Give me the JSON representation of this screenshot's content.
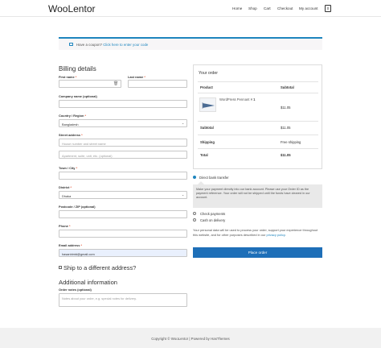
{
  "header": {
    "brand": "WooLentor",
    "nav": [
      "Home",
      "Shop",
      "Cart",
      "Checkout",
      "My account"
    ],
    "cart_count": "0"
  },
  "coupon": {
    "prefix": "Have a coupon? ",
    "link": "Click here to enter your code"
  },
  "billing": {
    "title": "Billing details",
    "required_mark": "*",
    "fields": {
      "first_name": {
        "label": "First name"
      },
      "last_name": {
        "label": "Last name"
      },
      "company": {
        "label": "Company name (optional)"
      },
      "country": {
        "label": "Country / Region",
        "value": "Bangladesh"
      },
      "street": {
        "label": "Street address",
        "placeholder1": "House number and street name",
        "placeholder2": "Apartment, suite, unit, etc. (optional)"
      },
      "town": {
        "label": "Town / City"
      },
      "district": {
        "label": "District",
        "value": "Dhaka"
      },
      "postcode": {
        "label": "Postcode / ZIP (optional)"
      },
      "phone": {
        "label": "Phone"
      },
      "email": {
        "label": "Email address",
        "value": "hasanbintd@gmail.com"
      }
    },
    "ship_different": "Ship to a different address?",
    "additional_title": "Additional information",
    "order_notes": {
      "label": "Order notes (optional)",
      "placeholder": "Notes about your order, e.g. special notes for delivery."
    }
  },
  "order": {
    "title": "Your order",
    "col_product": "Product",
    "col_subtotal": "Subtotal",
    "item_name": "WordPress Pennant",
    "item_qty": "× 1",
    "item_price": "$11.05",
    "subtotal_label": "Subtotal",
    "subtotal_value": "$11.05",
    "shipping_label": "Shipping",
    "shipping_value": "Free shipping",
    "total_label": "Total",
    "total_value": "$11.05"
  },
  "payment": {
    "bank": "Direct bank transfer",
    "bank_desc": "Make your payment directly into our bank account. Please use your Order ID as the payment reference. Your order will not be shipped until the funds have cleared in our account.",
    "check": "Check payments",
    "cod": "Cash on delivery",
    "privacy_text": "Your personal data will be used to process your order, support your experience throughout this website, and for other purposes described in our ",
    "privacy_link": "privacy policy",
    "privacy_end": ".",
    "place_order": "Place order"
  },
  "footer": {
    "text": "Copyright © WooLentor | Powered by HasThemes"
  },
  "colors": {
    "accent": "#1e85be",
    "button": "#1e6fb8",
    "required": "#e2401c"
  }
}
